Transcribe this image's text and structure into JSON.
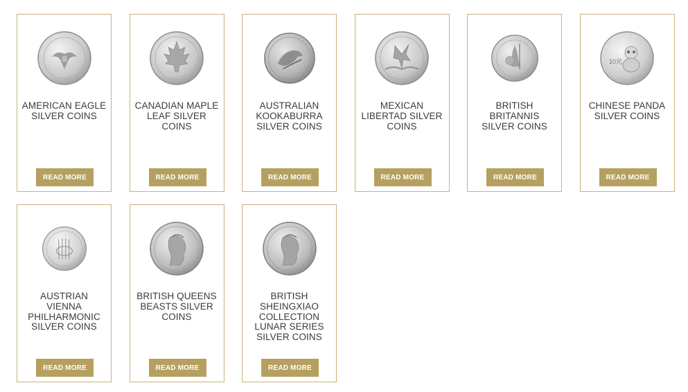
{
  "read_more_label": "READ MORE",
  "accent_color": "#b5a05f",
  "border_color": "#c8b27a",
  "products": [
    {
      "title": "AMERICAN EAGLE SILVER COINS",
      "coin_icon": "american-eagle-coin-icon"
    },
    {
      "title": "CANADIAN MAPLE LEAF SILVER COINS",
      "coin_icon": "maple-leaf-coin-icon"
    },
    {
      "title": "AUSTRALIAN KOOKABURRA SILVER COINS",
      "coin_icon": "kookaburra-coin-icon"
    },
    {
      "title": "MEXICAN LIBERTAD SILVER COINS",
      "coin_icon": "libertad-coin-icon"
    },
    {
      "title": "BRITISH BRITANNIS SILVER COINS",
      "coin_icon": "britannia-coin-icon"
    },
    {
      "title": "CHINESE PANDA SILVER COINS",
      "coin_icon": "panda-coin-icon"
    },
    {
      "title": "AUSTRIAN VIENNA PHILHARMONIC SILVER COINS",
      "coin_icon": "philharmonic-coin-icon"
    },
    {
      "title": "BRITISH QUEENS BEASTS SILVER COINS",
      "coin_icon": "queens-beasts-coin-icon"
    },
    {
      "title": "BRITISH SHEINGXIAO COLLECTION LUNAR SERIES SILVER COINS",
      "coin_icon": "lunar-series-coin-icon"
    }
  ]
}
